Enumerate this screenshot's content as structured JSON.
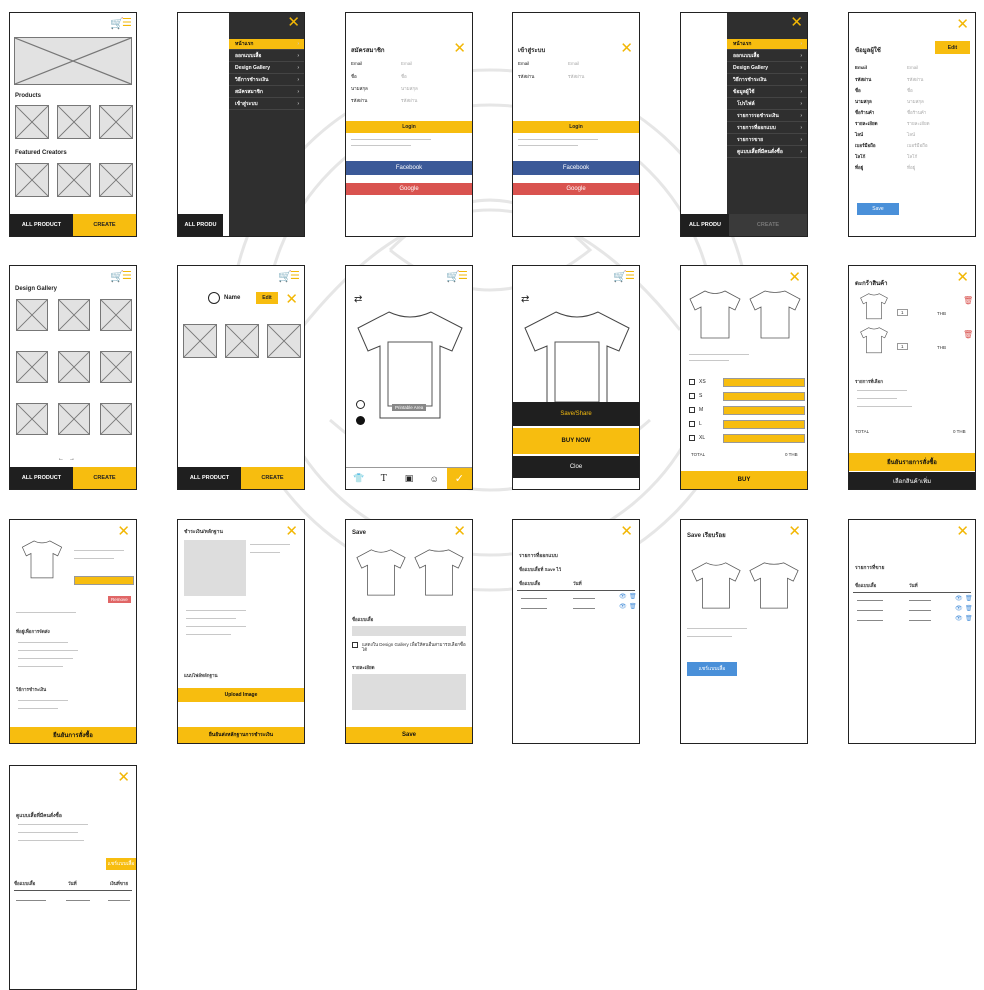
{
  "colors": {
    "accent": "#f7bd0f",
    "dark": "#1f1f1f",
    "facebook": "#3b5998",
    "google": "#d9534f",
    "blue": "#4a90d9"
  },
  "icons": {
    "close": "close-icon",
    "cart": "cart-icon",
    "menu": "hamburger-icon",
    "swap": "swap-icon"
  },
  "screen1": {
    "products": "Products",
    "creators": "Featured Creators",
    "all": "ALL PRODUCT",
    "create": "CREATE"
  },
  "screen2": {
    "menu": [
      "หน้าแรก",
      "ออกแบบเสื้อ",
      "Design Gallery",
      "วิธีการชำระเงิน",
      "สมัครสมาชิก",
      "เข้าสู่ระบบ"
    ],
    "all": "ALL PRODU"
  },
  "screen3": {
    "title": "สมัครสมาชิก",
    "fields": [
      {
        "label": "Email",
        "ph": "Email"
      },
      {
        "label": "ชื่อ",
        "ph": "ชื่อ"
      },
      {
        "label": "นามสกุล",
        "ph": "นามสกุล"
      },
      {
        "label": "รหัสผ่าน",
        "ph": "รหัสผ่าน"
      }
    ],
    "login": "Login",
    "facebook": "Facebook",
    "google": "Google"
  },
  "screen4": {
    "title": "เข้าสู่ระบบ",
    "fields": [
      {
        "label": "Email",
        "ph": "Email"
      },
      {
        "label": "รหัสผ่าน",
        "ph": "รหัสผ่าน"
      }
    ],
    "login": "Login",
    "facebook": "Facebook",
    "google": "Google"
  },
  "screen5": {
    "menu": [
      "หน้าแรก",
      "ออกแบบเสื้อ",
      "Design Gallery",
      "วิธีการชำระเงิน",
      "ข้อมูลผู้ใช้",
      "โปรไฟล์",
      "รายการรอชำระเงิน",
      "รายการที่ออกแบบ",
      "รายการขาย",
      "ดูแบบเสื้อที่มีคนสั่งซื้อ"
    ],
    "all": "ALL PRODU",
    "create": "CREATE"
  },
  "screen6": {
    "title": "ข้อมูลผู้ใช้",
    "edit": "Edit",
    "fields": [
      {
        "label": "Email",
        "ph": "Email"
      },
      {
        "label": "รหัสผ่าน",
        "ph": "รหัสผ่าน"
      },
      {
        "label": "ชื่อ",
        "ph": "ชื่อ"
      },
      {
        "label": "นามสกุล",
        "ph": "นามสกุล"
      },
      {
        "label": "ชื่อร้านค้า",
        "ph": "ชื่อร้านค้า"
      },
      {
        "label": "รายละเอียด",
        "ph": "รายละเอียด"
      },
      {
        "label": "ไลน์",
        "ph": "ไลน์"
      },
      {
        "label": "เบอร์มือถือ",
        "ph": "เบอร์มือถือ"
      },
      {
        "label": "โลโก้",
        "ph": "โลโก้"
      },
      {
        "label": "ที่อยู่",
        "ph": "ที่อยู่"
      }
    ],
    "save": "Save"
  },
  "screen7": {
    "title": "Design Gallery",
    "all": "ALL PRODUCT",
    "create": "CREATE"
  },
  "screen8": {
    "name": "Name",
    "edit": "Edit",
    "all": "ALL PRODUCT",
    "create": "CREATE"
  },
  "screen9": {
    "printable": "Printable Area"
  },
  "screen10": {
    "share": "Save/Share",
    "buy": "BUY NOW",
    "close": "Cloe"
  },
  "screen11": {
    "sizes": [
      "XS",
      "S",
      "M",
      "L",
      "XL"
    ],
    "total": "TOTAL",
    "total_val": "0 THB",
    "buy": "BUY"
  },
  "screen12": {
    "title": "ตะกร้าสินค้า",
    "qty": "1",
    "unit": "THB",
    "selected": "รายการที่เลือก",
    "total": "TOTAL",
    "total_val": "0 THB",
    "confirm": "ยืนยันรายการสั่งซื้อ",
    "more": "เลือกสินค้าเพิ่ม"
  },
  "screen13": {
    "remove": "Remove",
    "address": "ที่อยู่เพื่อการจัดส่ง",
    "pay": "วิธีการชำระเงิน",
    "confirm": "ยืนยันการสั่งซื้อ"
  },
  "screen14": {
    "title": "ชำระเงิน/หลักฐาน",
    "file": "แนบไฟล์หลักฐาน",
    "upload": "Upload Image",
    "confirm": "ยืนยันส่งหลักฐานการชำระเงิน"
  },
  "screen15": {
    "title": "Save",
    "name": "ชื่อแบบเสื้อ",
    "check": "แสดงใน Design Gallery เพื่อให้คนอื่นสามารถเลือกซื้อได้",
    "detail": "รายละเอียด",
    "save": "Save"
  },
  "screen16": {
    "title": "รายการที่ออกแบบ",
    "sub": "ชื่อแบบเสื้อที่ Save ไว้",
    "col1": "ชื่อแบบเสื้อ",
    "col2": "วันที่"
  },
  "screen17": {
    "title": "Save เรียบร้อย",
    "btn": "แชร์แบบเสื้อ"
  },
  "screen18": {
    "title": "รายการที่ขาย",
    "col1": "ชื่อแบบเสื้อ",
    "col2": "วันที่"
  },
  "screen19": {
    "title": "ดูแบบเสื้อที่มีคนสั่งซื้อ",
    "btn": "แชร์แบบเสื้อ",
    "col1": "ชื่อแบบเสื้อ",
    "col2": "วันที่",
    "col3": "เงินที่ขาย"
  }
}
